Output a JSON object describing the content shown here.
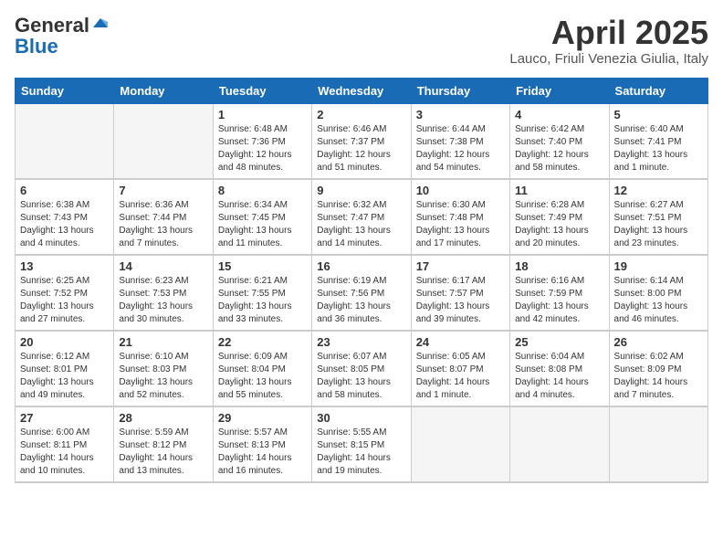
{
  "logo": {
    "general": "General",
    "blue": "Blue"
  },
  "title": "April 2025",
  "subtitle": "Lauco, Friuli Venezia Giulia, Italy",
  "days_of_week": [
    "Sunday",
    "Monday",
    "Tuesday",
    "Wednesday",
    "Thursday",
    "Friday",
    "Saturday"
  ],
  "weeks": [
    [
      {
        "day": "",
        "sunrise": "",
        "sunset": "",
        "daylight": ""
      },
      {
        "day": "",
        "sunrise": "",
        "sunset": "",
        "daylight": ""
      },
      {
        "day": "1",
        "sunrise": "6:48 AM",
        "sunset": "7:36 PM",
        "daylight": "12 hours and 48 minutes."
      },
      {
        "day": "2",
        "sunrise": "6:46 AM",
        "sunset": "7:37 PM",
        "daylight": "12 hours and 51 minutes."
      },
      {
        "day": "3",
        "sunrise": "6:44 AM",
        "sunset": "7:38 PM",
        "daylight": "12 hours and 54 minutes."
      },
      {
        "day": "4",
        "sunrise": "6:42 AM",
        "sunset": "7:40 PM",
        "daylight": "12 hours and 58 minutes."
      },
      {
        "day": "5",
        "sunrise": "6:40 AM",
        "sunset": "7:41 PM",
        "daylight": "13 hours and 1 minute."
      }
    ],
    [
      {
        "day": "6",
        "sunrise": "6:38 AM",
        "sunset": "7:43 PM",
        "daylight": "13 hours and 4 minutes."
      },
      {
        "day": "7",
        "sunrise": "6:36 AM",
        "sunset": "7:44 PM",
        "daylight": "13 hours and 7 minutes."
      },
      {
        "day": "8",
        "sunrise": "6:34 AM",
        "sunset": "7:45 PM",
        "daylight": "13 hours and 11 minutes."
      },
      {
        "day": "9",
        "sunrise": "6:32 AM",
        "sunset": "7:47 PM",
        "daylight": "13 hours and 14 minutes."
      },
      {
        "day": "10",
        "sunrise": "6:30 AM",
        "sunset": "7:48 PM",
        "daylight": "13 hours and 17 minutes."
      },
      {
        "day": "11",
        "sunrise": "6:28 AM",
        "sunset": "7:49 PM",
        "daylight": "13 hours and 20 minutes."
      },
      {
        "day": "12",
        "sunrise": "6:27 AM",
        "sunset": "7:51 PM",
        "daylight": "13 hours and 23 minutes."
      }
    ],
    [
      {
        "day": "13",
        "sunrise": "6:25 AM",
        "sunset": "7:52 PM",
        "daylight": "13 hours and 27 minutes."
      },
      {
        "day": "14",
        "sunrise": "6:23 AM",
        "sunset": "7:53 PM",
        "daylight": "13 hours and 30 minutes."
      },
      {
        "day": "15",
        "sunrise": "6:21 AM",
        "sunset": "7:55 PM",
        "daylight": "13 hours and 33 minutes."
      },
      {
        "day": "16",
        "sunrise": "6:19 AM",
        "sunset": "7:56 PM",
        "daylight": "13 hours and 36 minutes."
      },
      {
        "day": "17",
        "sunrise": "6:17 AM",
        "sunset": "7:57 PM",
        "daylight": "13 hours and 39 minutes."
      },
      {
        "day": "18",
        "sunrise": "6:16 AM",
        "sunset": "7:59 PM",
        "daylight": "13 hours and 42 minutes."
      },
      {
        "day": "19",
        "sunrise": "6:14 AM",
        "sunset": "8:00 PM",
        "daylight": "13 hours and 46 minutes."
      }
    ],
    [
      {
        "day": "20",
        "sunrise": "6:12 AM",
        "sunset": "8:01 PM",
        "daylight": "13 hours and 49 minutes."
      },
      {
        "day": "21",
        "sunrise": "6:10 AM",
        "sunset": "8:03 PM",
        "daylight": "13 hours and 52 minutes."
      },
      {
        "day": "22",
        "sunrise": "6:09 AM",
        "sunset": "8:04 PM",
        "daylight": "13 hours and 55 minutes."
      },
      {
        "day": "23",
        "sunrise": "6:07 AM",
        "sunset": "8:05 PM",
        "daylight": "13 hours and 58 minutes."
      },
      {
        "day": "24",
        "sunrise": "6:05 AM",
        "sunset": "8:07 PM",
        "daylight": "14 hours and 1 minute."
      },
      {
        "day": "25",
        "sunrise": "6:04 AM",
        "sunset": "8:08 PM",
        "daylight": "14 hours and 4 minutes."
      },
      {
        "day": "26",
        "sunrise": "6:02 AM",
        "sunset": "8:09 PM",
        "daylight": "14 hours and 7 minutes."
      }
    ],
    [
      {
        "day": "27",
        "sunrise": "6:00 AM",
        "sunset": "8:11 PM",
        "daylight": "14 hours and 10 minutes."
      },
      {
        "day": "28",
        "sunrise": "5:59 AM",
        "sunset": "8:12 PM",
        "daylight": "14 hours and 13 minutes."
      },
      {
        "day": "29",
        "sunrise": "5:57 AM",
        "sunset": "8:13 PM",
        "daylight": "14 hours and 16 minutes."
      },
      {
        "day": "30",
        "sunrise": "5:55 AM",
        "sunset": "8:15 PM",
        "daylight": "14 hours and 19 minutes."
      },
      {
        "day": "",
        "sunrise": "",
        "sunset": "",
        "daylight": ""
      },
      {
        "day": "",
        "sunrise": "",
        "sunset": "",
        "daylight": ""
      },
      {
        "day": "",
        "sunrise": "",
        "sunset": "",
        "daylight": ""
      }
    ]
  ],
  "labels": {
    "sunrise": "Sunrise:",
    "sunset": "Sunset:",
    "daylight": "Daylight:"
  }
}
